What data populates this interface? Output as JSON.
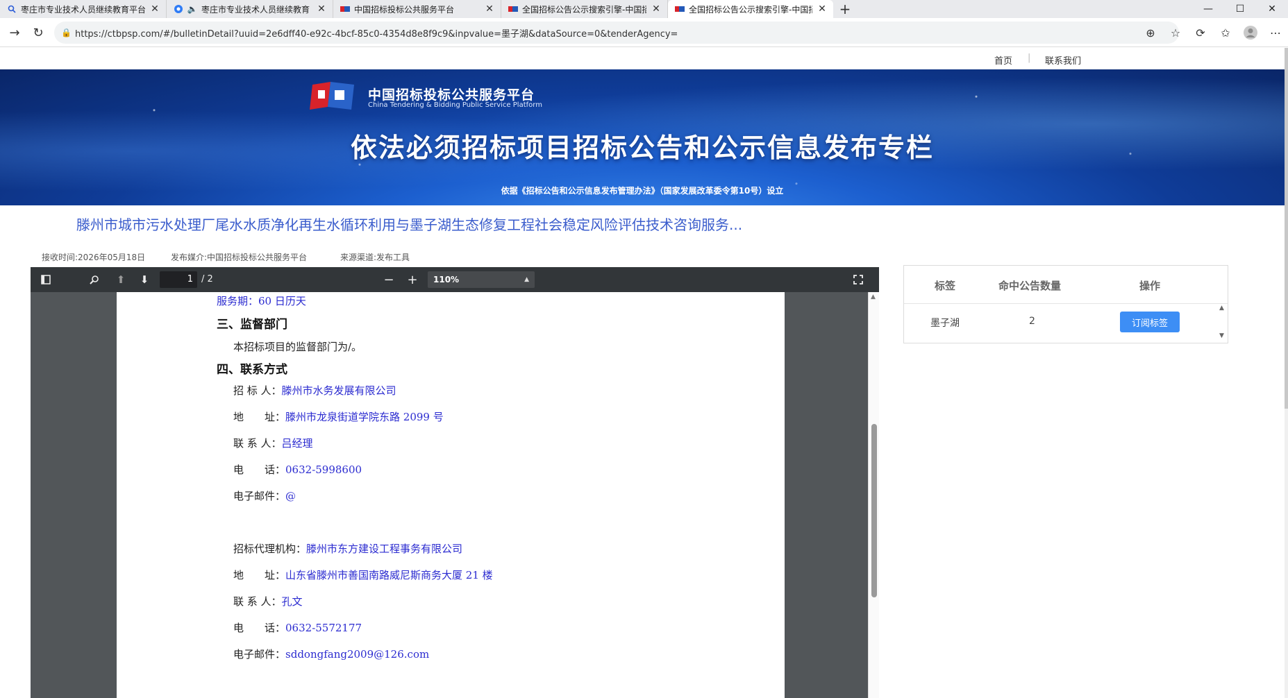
{
  "browser": {
    "tabs": [
      {
        "title": "枣庄市专业技术人员继续教育平台"
      },
      {
        "title": "枣庄市专业技术人员继续教育"
      },
      {
        "title": "中国招标投标公共服务平台"
      },
      {
        "title": "全国招标公告公示搜索引擎-中国招"
      },
      {
        "title": "全国招标公告公示搜索引擎-中国招"
      }
    ],
    "url": "https://ctbpsp.com/#/bulletinDetail?uuid=2e6dff40-e92c-4bcf-85c0-4354d8e8f9c9&inpvalue=墨子湖&dataSource=0&tenderAgency="
  },
  "topnav": {
    "home": "首页",
    "contact": "联系我们",
    "separator": "|"
  },
  "banner": {
    "logo_cn": "中国招标投标公共服务平台",
    "logo_en": "China Tendering & Bidding Public Service Platform",
    "headline": "依法必须招标项目招标公告和公示信息发布专栏",
    "basis": "依据《招标公告和公示信息发布管理办法》（国家发展改革委令第10号）设立"
  },
  "bulletin": {
    "title": "滕州市城市污水处理厂尾水水质净化再生水循环利用与墨子湖生态修复工程社会稳定风险评估技术咨询服务...",
    "received": "接收时间:2026年05月18日",
    "media": "发布媒介:中国招标投标公共服务平台",
    "channel": "来源渠道:发布工具"
  },
  "pdf_viewer": {
    "current_page": "1",
    "total_pages": "/ 2",
    "zoom": "110%"
  },
  "pdf_content": {
    "service_period_label": "服务期：",
    "service_period_value": "60 日历天",
    "section3": "三、监督部门",
    "supervision": "本招标项目的监督部门为/。",
    "section4": "四、联系方式",
    "tenderer_label": "招 标 人：",
    "tenderer_value": "滕州市水务发展有限公司",
    "address1_label": "地　　址：",
    "address1_value": "滕州市龙泉街道学院东路 2099 号",
    "contact1_label": "联 系 人：",
    "contact1_value": "吕经理",
    "phone1_label": "电　　话：",
    "phone1_value": "0632-5998600",
    "email1_label": "电子邮件：",
    "email1_value": "@",
    "agency_label": "招标代理机构：",
    "agency_value": "滕州市东方建设工程事务有限公司",
    "address2_label": "地　　址：",
    "address2_value": "山东省滕州市善国南路威尼斯商务大厦 21 楼",
    "contact2_label": "联 系 人：",
    "contact2_value": "孔文",
    "phone2_label": "电　　话：",
    "phone2_value": "0632-5572177",
    "email2_label": "电子邮件：",
    "email2_value": "sddongfang2009@126.com"
  },
  "tag_panel": {
    "headers": [
      "标签",
      "命中公告数量",
      "操作"
    ],
    "rows": [
      {
        "tag": "墨子湖",
        "count": "2",
        "action": "订阅标签"
      }
    ]
  },
  "colors": {
    "accent": "#3d8ef5",
    "title_blue": "#3a5ccc",
    "pdf_value_blue": "#2b2bd0"
  }
}
